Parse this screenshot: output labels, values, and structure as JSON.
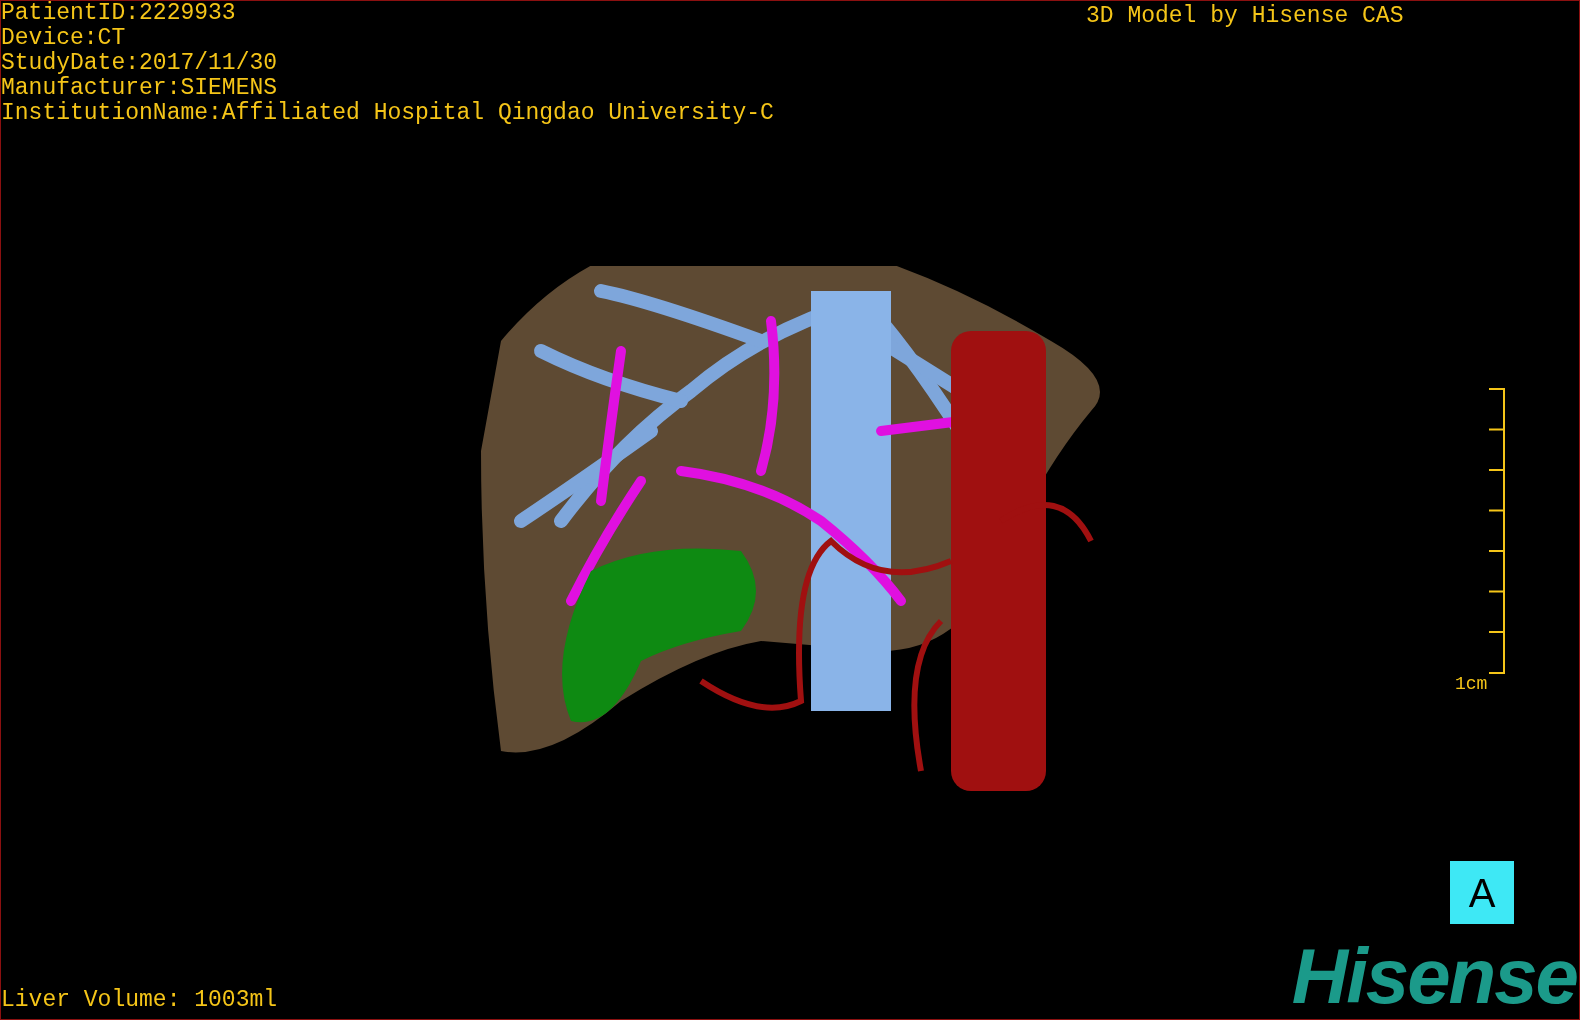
{
  "info_lines": [
    "PatientID:2229933",
    "Device:CT",
    "StudyDate:2017/11/30",
    "Manufacturer:SIEMENS",
    "InstitutionName:Affiliated Hospital Qingdao University-C"
  ],
  "credit": "3D Model by Hisense CAS",
  "scale_label": "1cm",
  "orientation": "A",
  "volume": "Liver Volume: 1003ml",
  "logo": "Hisense"
}
